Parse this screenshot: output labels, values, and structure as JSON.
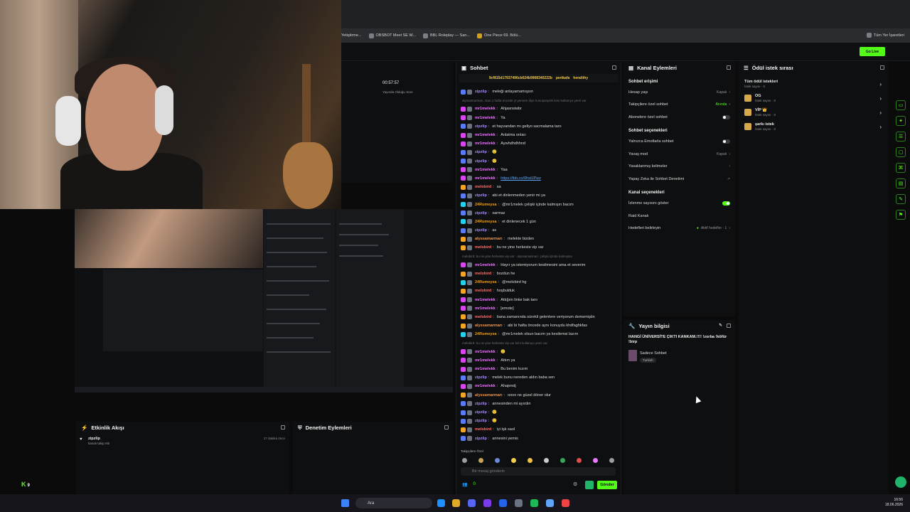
{
  "browser": {
    "bookmarks": [
      "Yetiştirme...",
      "OBSBOT Meet SE W...",
      "BBL Roleplay — San...",
      "One Piece 69. Bölü..."
    ],
    "all_bookmarks": "Tüm Yer İşaretleri"
  },
  "header": {
    "go_live": "Go Live"
  },
  "stream_timer": {
    "value": "00:57:57",
    "label": "Yayında Olduğu Süre"
  },
  "chat": {
    "title": "Sohbet",
    "pinned_user": "9cf815d17937496cb624b9908340222b",
    "pinned_tags": [
      "pertkafa",
      "heralithy"
    ],
    "messages": [
      {
        "user": "zipzlip",
        "color": "#a78bfa",
        "text": "meleği anlayamamışsın",
        "badge": "#5b7cfa"
      },
      {
        "system": "alyssamarmarı, stan 1 hafta öncede yt yemem diye konuşsaydık kimi kullanıyo yemi var"
      },
      {
        "user": "mr1melekk",
        "color": "#e879f9",
        "text": "Ahjasnsiwbr",
        "badge": "#d946ef"
      },
      {
        "user": "mr1melekk",
        "color": "#e879f9",
        "text": "Ya",
        "badge": "#d946ef"
      },
      {
        "user": "zipzlip",
        "color": "#a78bfa",
        "text": "et hayvandan mı geliyo sacmalama taro",
        "badge": "#5b7cfa"
      },
      {
        "user": "mr1melekk",
        "color": "#e879f9",
        "text": "Anlatma onları",
        "badge": "#d946ef"
      },
      {
        "user": "mr1melekk",
        "color": "#e879f9",
        "text": "Aywhdhdhhnd",
        "badge": "#d946ef"
      },
      {
        "user": "zipzlip",
        "color": "#a78bfa",
        "text": "🙂",
        "badge": "#5b7cfa"
      },
      {
        "user": "zipzlip",
        "color": "#a78bfa",
        "text": "🙂",
        "badge": "#5b7cfa"
      },
      {
        "user": "mr1melekk",
        "color": "#e879f9",
        "text": "Yaa",
        "badge": "#d946ef"
      },
      {
        "user": "mr1melekk",
        "color": "#e879f9",
        "text": "https://ibb.co/0fodJPwz",
        "badge": "#d946ef"
      },
      {
        "user": "melobird",
        "color": "#f87171",
        "text": "sa",
        "badge": "#f5a524"
      },
      {
        "user": "zipzlip",
        "color": "#a78bfa",
        "text": "abi et dinlenmeden yenir mi ya",
        "badge": "#5b7cfa"
      },
      {
        "user": "24Rumeysa",
        "color": "#f59e0b",
        "text": "@mr1melek çelişki içinde kalmışın bacım",
        "badge": "#22d3ee"
      },
      {
        "user": "zipzlip",
        "color": "#a78bfa",
        "text": "sarmaz",
        "badge": "#5b7cfa"
      },
      {
        "user": "24Rumeysa",
        "color": "#f59e0b",
        "text": "et dinlenecek 1 gün",
        "badge": "#22d3ee"
      },
      {
        "user": "zipzlip",
        "color": "#a78bfa",
        "text": "as",
        "badge": "#5b7cfa"
      },
      {
        "user": "alyssamarmarı",
        "color": "#fb923c",
        "text": "melekte bizden",
        "badge": "#f5a524"
      },
      {
        "user": "melobird",
        "color": "#f87171",
        "text": "bu ne yine herkeste vip var",
        "badge": "#f5a524"
      },
      {
        "system": "melobird: bu ne yine herkeste vip var · alyssamarmarı: çelişki içinde kalmışsın"
      },
      {
        "user": "mr1melekk",
        "color": "#e879f9",
        "text": "Hayır ya istemiyorum kesilmesini ama et severim",
        "badge": "#d946ef"
      },
      {
        "user": "melobird",
        "color": "#f87171",
        "text": "bozdun he",
        "badge": "#f5a524"
      },
      {
        "user": "24Rumeysa",
        "color": "#f59e0b",
        "text": "@melobird hg",
        "badge": "#22d3ee"
      },
      {
        "user": "melobird",
        "color": "#f87171",
        "text": "hoşbulduk",
        "badge": "#f5a524"
      },
      {
        "user": "mr1melekk",
        "color": "#e879f9",
        "text": "Attığım linke bak taro",
        "badge": "#d946ef"
      },
      {
        "user": "mr1melekk",
        "color": "#e879f9",
        "text": "[emote]",
        "badge": "#d946ef"
      },
      {
        "user": "melobird",
        "color": "#f87171",
        "text": "bana zamanında sürekli gelenlere veriyorum dememiştin",
        "badge": "#f5a524"
      },
      {
        "user": "alyssamarmarı",
        "color": "#fb923c",
        "text": "abi bi hafta öncede aynı konuydu khdfaghkfas",
        "badge": "#f5a524"
      },
      {
        "user": "24Rumeysa",
        "color": "#f59e0b",
        "text": "@mr1melek olsun bacım ya kesilemsi lazım",
        "badge": "#22d3ee"
      },
      {
        "system": "melobird: bu ne yine herkeste vip var kimi kullanıyo yemi var"
      },
      {
        "user": "mr1melekk",
        "color": "#e879f9",
        "text": "🙂",
        "badge": "#d946ef"
      },
      {
        "user": "mr1melekk",
        "color": "#e879f9",
        "text": "Attım ya",
        "badge": "#d946ef"
      },
      {
        "user": "mr1melekk",
        "color": "#e879f9",
        "text": "Bu benim kızım",
        "badge": "#d946ef"
      },
      {
        "user": "zipzlip",
        "color": "#a78bfa",
        "text": "melek bunu nereden aldın baba sen",
        "badge": "#5b7cfa"
      },
      {
        "user": "mr1melekk",
        "color": "#e879f9",
        "text": "Ahajendj",
        "badge": "#d946ef"
      },
      {
        "user": "alyssamarmarı",
        "color": "#fb923c",
        "text": "oooo ne güzel döner olur",
        "badge": "#f5a524"
      },
      {
        "user": "zipzlip",
        "color": "#a78bfa",
        "text": "annesinden mi ayırdın",
        "badge": "#5b7cfa"
      },
      {
        "user": "zipzlip",
        "color": "#a78bfa",
        "text": "🙂",
        "badge": "#5b7cfa"
      },
      {
        "user": "zipzlip",
        "color": "#a78bfa",
        "text": "🙂",
        "badge": "#5b7cfa"
      },
      {
        "user": "melobird",
        "color": "#f87171",
        "text": "iyi tşk saol",
        "badge": "#f5a524"
      },
      {
        "user": "zipzlip",
        "color": "#a78bfa",
        "text": "annesini yemis",
        "badge": "#5b7cfa"
      }
    ],
    "followers_only": "Takipçilere Özel",
    "input_placeholder": "Bir mesaj gönderin",
    "send": "Gönder",
    "viewer_count": "0"
  },
  "channel_actions": {
    "title": "Kanal Eylemleri",
    "chat_access": "Sohbet erişimi",
    "account_age": {
      "label": "Hesap yaşı",
      "value": "Kapalı"
    },
    "followers_only": {
      "label": "Takipçilere özel sohbet",
      "value": "Anında"
    },
    "subscribers_only": {
      "label": "Abonelere özel sohbet"
    },
    "chat_options": "Sohbet seçenekleri",
    "emotes_only": {
      "label": "Yalnızca Emotlarla sohbet"
    },
    "slow_mode": {
      "label": "Yavaş mod",
      "value": "Kapalı"
    },
    "banned_words": {
      "label": "Yasaklanmış kelimeler"
    },
    "ai_moderation": {
      "label": "Yapay Zeka ile Sohbet Denetimi"
    },
    "channel_options": "Kanal seçenekleri",
    "show_viewers": {
      "label": "İzlenme sayısını göster"
    },
    "raid": {
      "label": "Raid Kanalı"
    },
    "goals": {
      "label": "Hedefleri belirleyin",
      "value": "Aktif hedefler · 1"
    }
  },
  "rewards": {
    "title": "Ödül istek sırası",
    "all": {
      "label": "Tüm ödül istekleri",
      "sub": "İstek sayısı · 0"
    },
    "items": [
      {
        "label": "OG",
        "sub": "İstek sayısı · 0"
      },
      {
        "label": "VİP 👑",
        "sub": "İstek sayısı · 0"
      },
      {
        "label": "şarkı istek",
        "sub": "İstek sayısı · 0"
      }
    ]
  },
  "stream_info": {
    "title": "Yayın bilgisi",
    "stream_title": "HANGİ ÜNİVERSİTE ÇIKTI KANKAM.!!!! !zorba !köfür !birp",
    "category": "Sadece Sohbet",
    "language": "Turkish"
  },
  "activity": {
    "title": "Etkinlik Akışı",
    "items": [
      {
        "user": "zipzlip",
        "text": "kanalı takip etti",
        "time": "17 dakika önce"
      }
    ]
  },
  "mod": {
    "title": "Denetim Eylemleri"
  },
  "taskbar": {
    "search": "Ara",
    "time": "16:56",
    "date": "18.06.2026"
  },
  "logo": {
    "text": "K",
    "count": "9"
  },
  "colors": {
    "brand": "#53fc18",
    "panel": "#0e0f10",
    "bg": "#0b0b0c"
  }
}
